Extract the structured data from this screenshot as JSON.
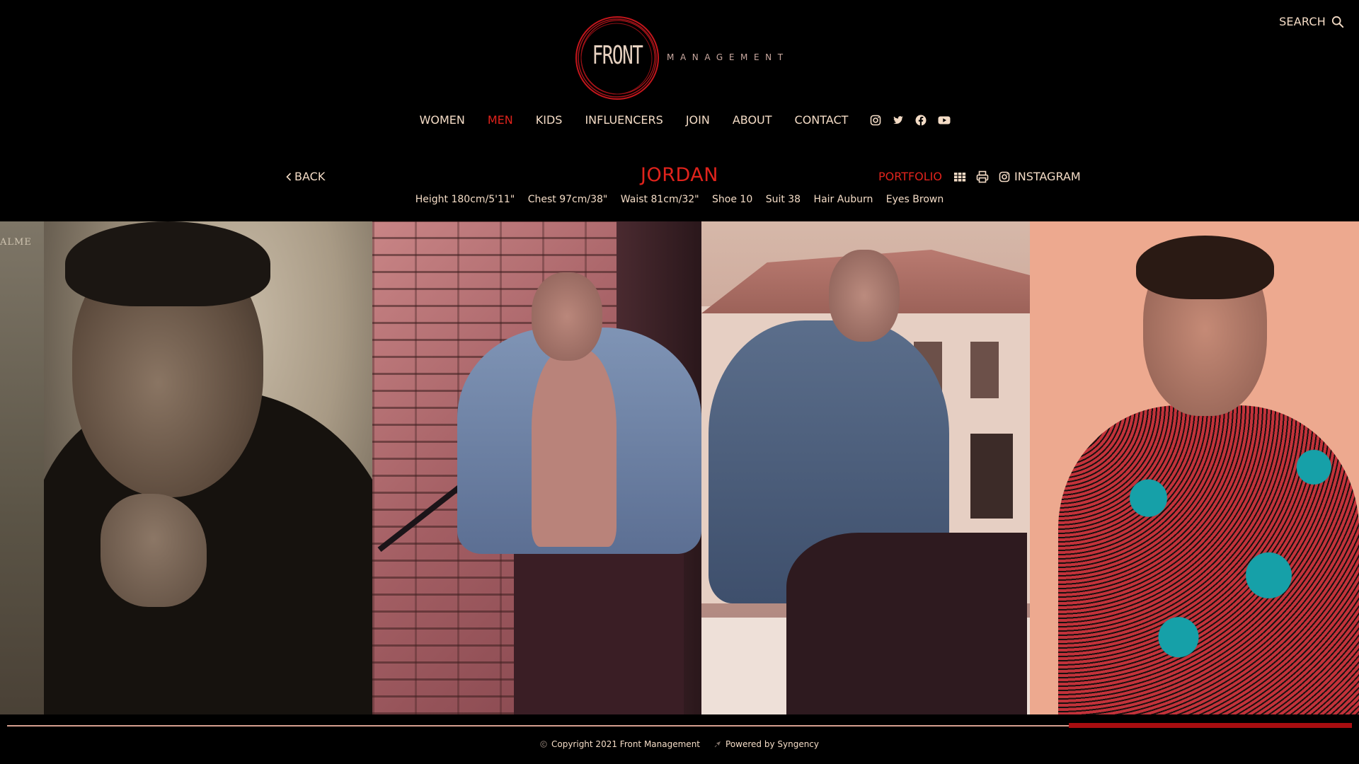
{
  "header": {
    "search_label": "SEARCH",
    "logo": {
      "front": "FRONT",
      "management": "MANAGEMENT"
    }
  },
  "nav": {
    "items": [
      {
        "label": "WOMEN",
        "active": false
      },
      {
        "label": "MEN",
        "active": true
      },
      {
        "label": "KIDS",
        "active": false
      },
      {
        "label": "INFLUENCERS",
        "active": false
      },
      {
        "label": "JOIN",
        "active": false
      },
      {
        "label": "ABOUT",
        "active": false
      },
      {
        "label": "CONTACT",
        "active": false
      }
    ],
    "socials": [
      "instagram-icon",
      "twitter-icon",
      "facebook-icon",
      "youtube-icon"
    ]
  },
  "model": {
    "back_label": "BACK",
    "name": "JORDAN",
    "portfolio_label": "PORTFOLIO",
    "instagram_label": "INSTAGRAM",
    "measurements": [
      "Height 180cm/5'11\"",
      "Chest 97cm/38\"",
      "Waist 81cm/32\"",
      "Shoe 10",
      "Suit 38",
      "Hair Auburn",
      "Eyes Brown"
    ]
  },
  "gallery": {
    "partial_photo_text": "ALME"
  },
  "footer": {
    "copyright": "Copyright 2021 Front Management",
    "powered": "Powered by Syngency"
  },
  "colors": {
    "accent": "#e0231c",
    "text": "#f4dcc6",
    "background": "#000000",
    "progress_fill": "#a80d10"
  }
}
